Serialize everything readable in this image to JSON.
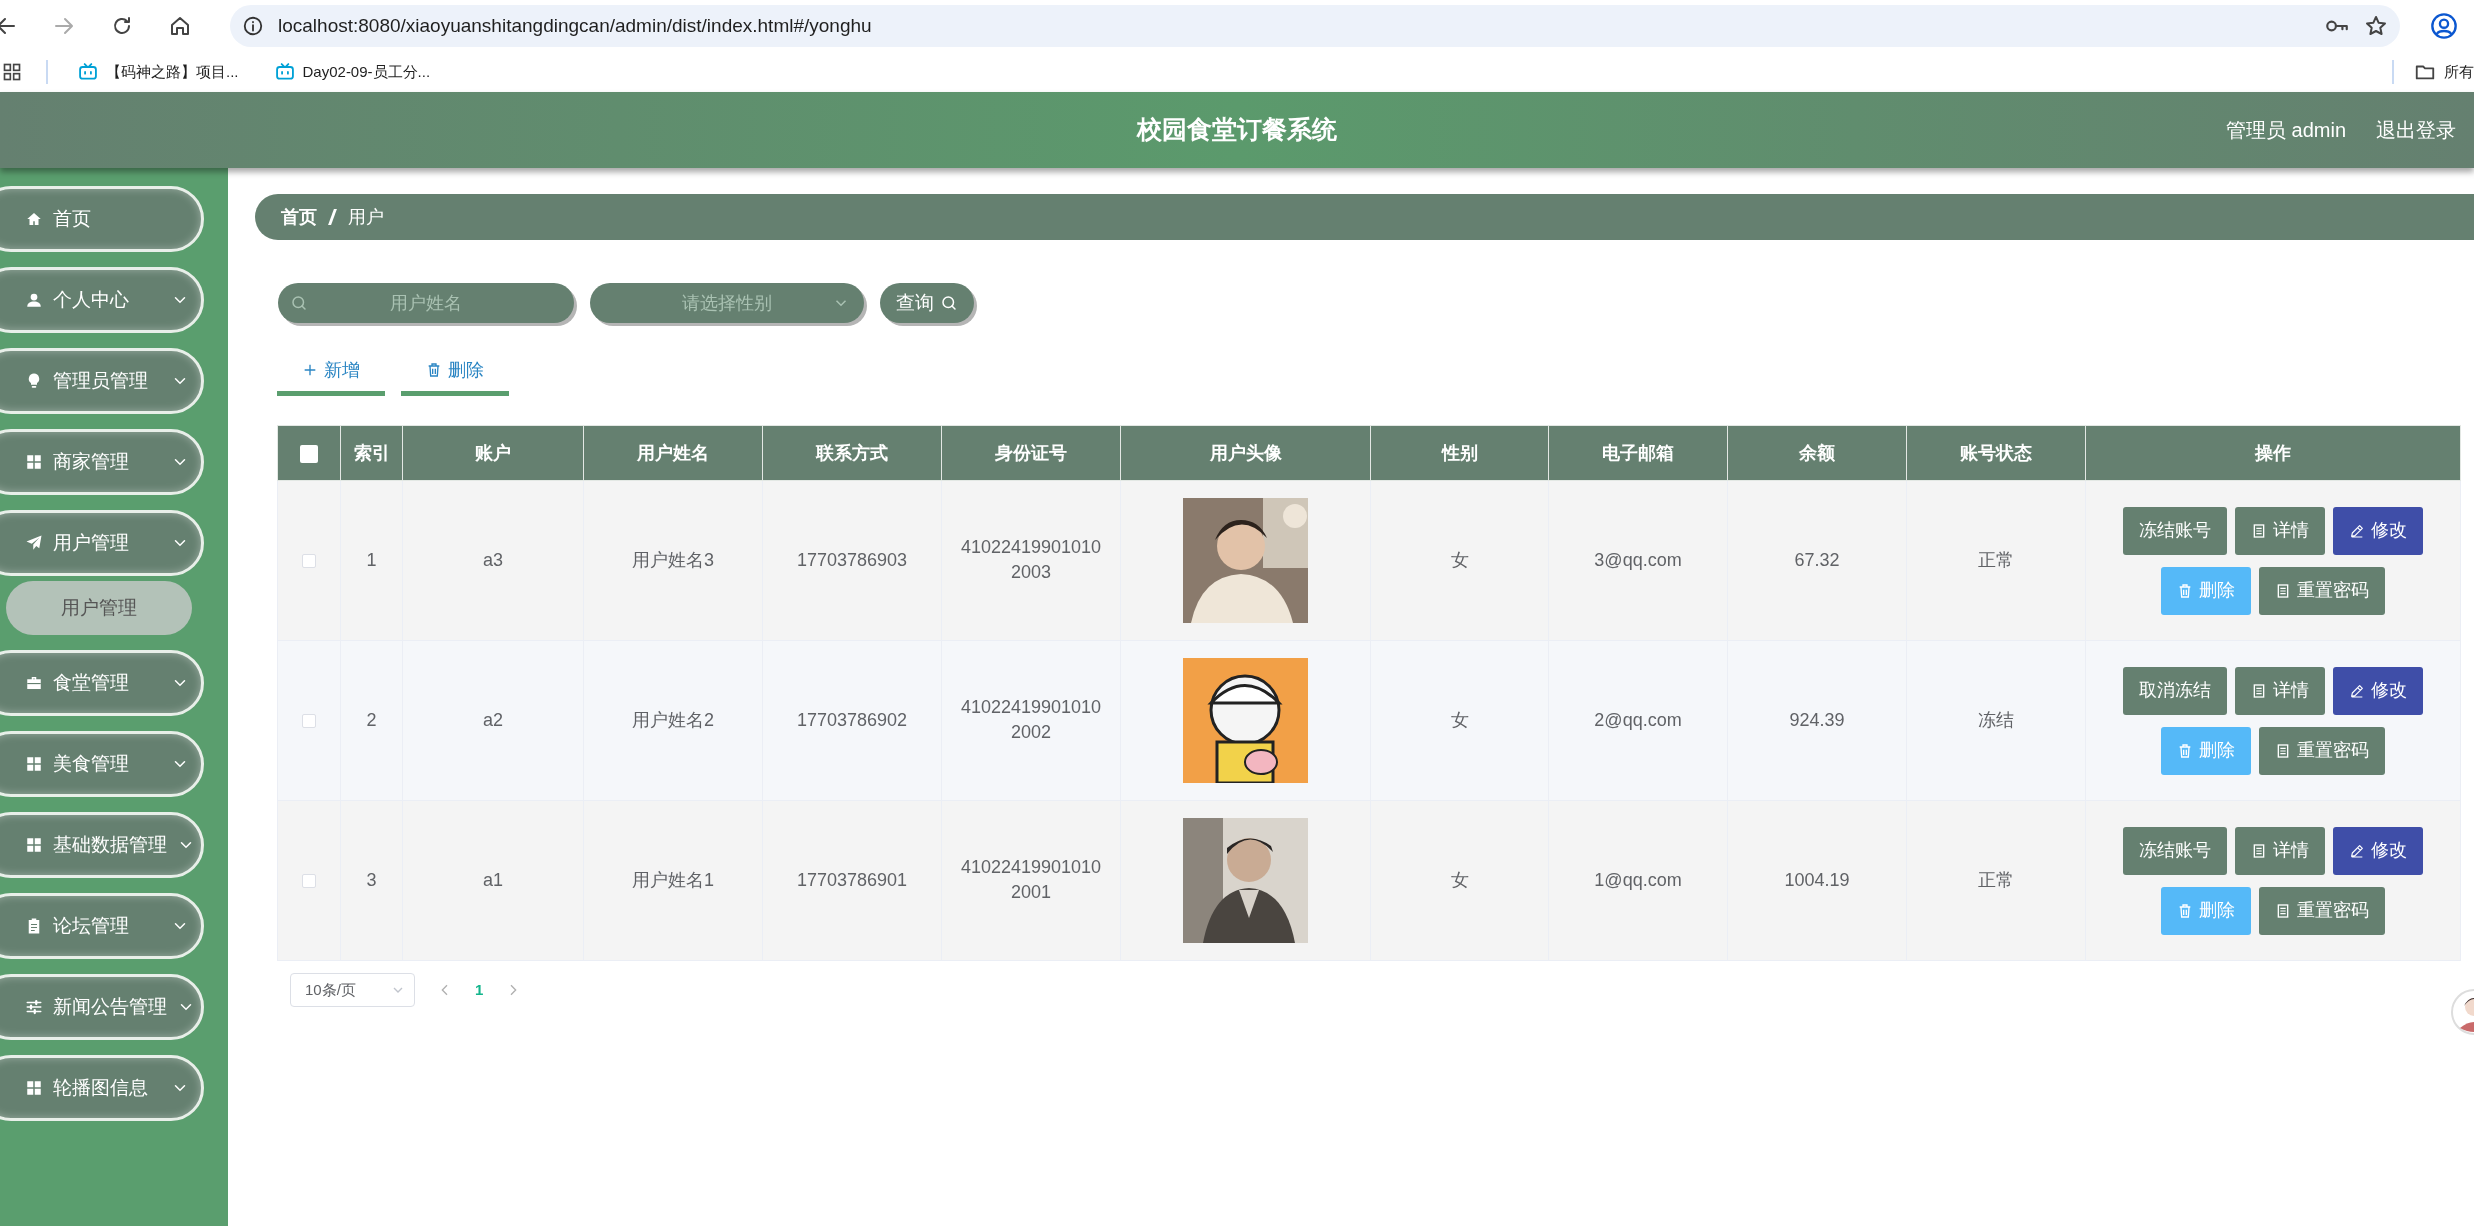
{
  "browser": {
    "url": "localhost:8080/xiaoyuanshitangdingcan/admin/dist/index.html#/yonghu",
    "bookmarks": [
      "【码神之路】项目...",
      "Day02-09-员工分..."
    ],
    "all_bookmarks": "所有"
  },
  "header": {
    "title": "校园食堂订餐系统",
    "user": "管理员 admin",
    "logout": "退出登录"
  },
  "sidebar": {
    "items": [
      {
        "kind": "link",
        "label": "首页"
      },
      {
        "kind": "group",
        "label": "个人中心"
      },
      {
        "kind": "group",
        "label": "管理员管理"
      },
      {
        "kind": "group",
        "label": "商家管理"
      },
      {
        "kind": "group",
        "label": "用户管理",
        "expanded": true,
        "children": [
          {
            "label": "用户管理",
            "selected": true
          }
        ]
      },
      {
        "kind": "group",
        "label": "食堂管理"
      },
      {
        "kind": "group",
        "label": "美食管理"
      },
      {
        "kind": "group",
        "label": "基础数据管理"
      },
      {
        "kind": "group",
        "label": "论坛管理"
      },
      {
        "kind": "group",
        "label": "新闻公告管理"
      },
      {
        "kind": "group",
        "label": "轮播图信息"
      }
    ]
  },
  "breadcrumb": [
    "首页",
    "用户"
  ],
  "search": {
    "name_placeholder": "用户姓名",
    "gender_placeholder": "请选择性别",
    "button": "查询"
  },
  "toolbar": [
    {
      "kind": "add",
      "label": "新增"
    },
    {
      "kind": "delete",
      "label": "删除"
    }
  ],
  "table": {
    "select_all": {
      "checked": false
    },
    "columns": [
      "索引",
      "账户",
      "用户姓名",
      "联系方式",
      "身份证号",
      "用户头像",
      "性别",
      "电子邮箱",
      "余额",
      "账号状态",
      "操作"
    ],
    "rows": [
      {
        "checked": false,
        "cells": [
          "1",
          "a3",
          "用户姓名3",
          "17703786903",
          "410224199010102003"
        ],
        "avatar": {
          "kind": "picture"
        },
        "cells_after": [
          "女",
          "3@qq.com",
          "67.32",
          "正常"
        ],
        "actions": [
          {
            "kind": "freeze",
            "label": "冻结账号"
          },
          {
            "kind": "detail",
            "label": "详情"
          },
          {
            "kind": "edit",
            "label": "修改"
          },
          {
            "kind": "delete",
            "label": "删除"
          },
          {
            "kind": "reset",
            "label": "重置密码"
          }
        ]
      },
      {
        "checked": false,
        "cells": [
          "2",
          "a2",
          "用户姓名2",
          "17703786902",
          "410224199010102002"
        ],
        "avatar": {
          "kind": "picture"
        },
        "cells_after": [
          "女",
          "2@qq.com",
          "924.39",
          "冻结"
        ],
        "actions": [
          {
            "kind": "freeze",
            "label": "取消冻结"
          },
          {
            "kind": "detail",
            "label": "详情"
          },
          {
            "kind": "edit",
            "label": "修改"
          },
          {
            "kind": "delete",
            "label": "删除"
          },
          {
            "kind": "reset",
            "label": "重置密码"
          }
        ]
      },
      {
        "checked": false,
        "cells": [
          "3",
          "a1",
          "用户姓名1",
          "17703786901",
          "410224199010102001"
        ],
        "avatar": {
          "kind": "picture"
        },
        "cells_after": [
          "女",
          "1@qq.com",
          "1004.19",
          "正常"
        ],
        "actions": [
          {
            "kind": "freeze",
            "label": "冻结账号"
          },
          {
            "kind": "detail",
            "label": "详情"
          },
          {
            "kind": "edit",
            "label": "修改"
          },
          {
            "kind": "delete",
            "label": "删除"
          },
          {
            "kind": "reset",
            "label": "重置密码"
          }
        ]
      }
    ]
  },
  "pagination": {
    "page_size": "10条/页",
    "pages": [
      {
        "label": "1",
        "selected": true
      }
    ]
  }
}
